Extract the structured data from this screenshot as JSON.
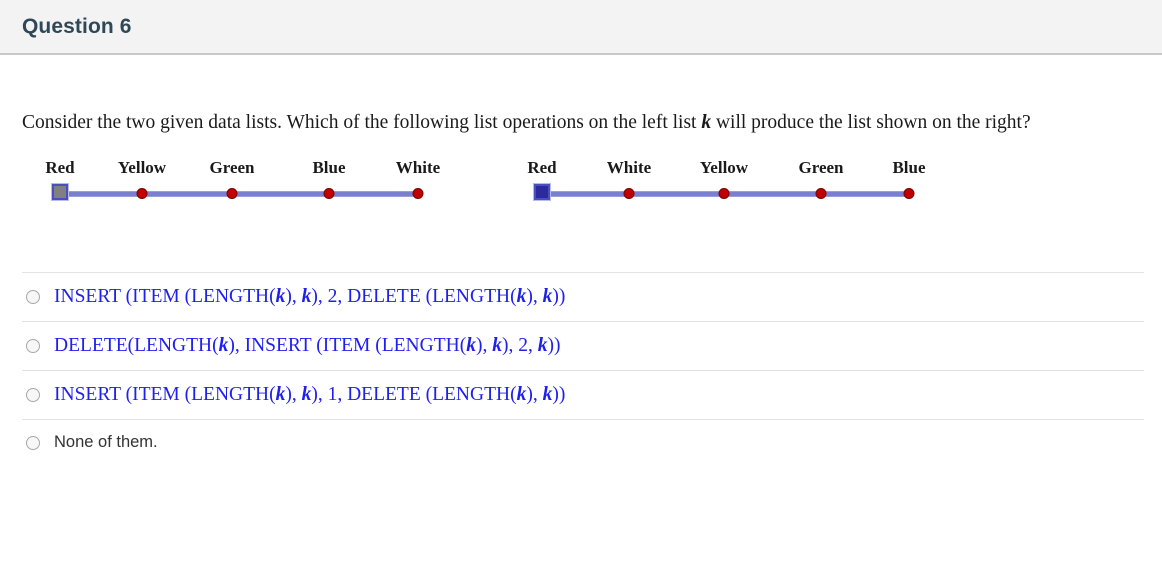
{
  "header": {
    "title": "Question 6"
  },
  "prompt": {
    "before_var": "Consider the two given data lists. Which of the following list operations on the left list ",
    "var": "k",
    "after_var": " will produce the list shown on the right?"
  },
  "colors": {
    "header_background": "#f3f3f3",
    "title_text": "#2f4858",
    "option_text": "#2020ee",
    "line": "#7b7fd0",
    "dot": "#c00000",
    "square_left": "#808080",
    "square_right": "#2b2b9e"
  },
  "chart_data": {
    "type": "scatter",
    "lists": [
      {
        "name": "left-list",
        "items": [
          "Red",
          "Yellow",
          "Green",
          "Blue",
          "White"
        ],
        "x_positions": [
          28,
          110,
          200,
          297,
          386
        ],
        "marker_types": [
          "square-gray",
          "dot",
          "dot",
          "dot",
          "dot"
        ]
      },
      {
        "name": "right-list",
        "items": [
          "Red",
          "White",
          "Yellow",
          "Green",
          "Blue"
        ],
        "x_positions": [
          28,
          115,
          210,
          307,
          395
        ],
        "marker_types": [
          "square-blue",
          "dot",
          "dot",
          "dot",
          "dot"
        ]
      }
    ]
  },
  "options": [
    {
      "id": "option-1",
      "selected": false,
      "style": "formula",
      "segments": [
        {
          "t": "INSERT (ITEM (LENGTH(",
          "v": false
        },
        {
          "t": "k",
          "v": true
        },
        {
          "t": "), ",
          "v": false
        },
        {
          "t": "k",
          "v": true
        },
        {
          "t": "), 2, DELETE (LENGTH(",
          "v": false
        },
        {
          "t": "k",
          "v": true
        },
        {
          "t": "), ",
          "v": false
        },
        {
          "t": "k",
          "v": true
        },
        {
          "t": "))",
          "v": false
        }
      ],
      "text": "INSERT (ITEM (LENGTH(k), k), 2, DELETE (LENGTH(k), k))"
    },
    {
      "id": "option-2",
      "selected": false,
      "style": "formula",
      "segments": [
        {
          "t": "DELETE(LENGTH(",
          "v": false
        },
        {
          "t": "k",
          "v": true
        },
        {
          "t": "), INSERT (ITEM (LENGTH(",
          "v": false
        },
        {
          "t": "k",
          "v": true
        },
        {
          "t": "), ",
          "v": false
        },
        {
          "t": "k",
          "v": true
        },
        {
          "t": "), 2, ",
          "v": false
        },
        {
          "t": "k",
          "v": true
        },
        {
          "t": "))",
          "v": false
        }
      ],
      "text": "DELETE(LENGTH(k), INSERT (ITEM (LENGTH(k), k), 2, k))"
    },
    {
      "id": "option-3",
      "selected": false,
      "style": "formula",
      "segments": [
        {
          "t": "INSERT (ITEM (LENGTH(",
          "v": false
        },
        {
          "t": "k",
          "v": true
        },
        {
          "t": "), ",
          "v": false
        },
        {
          "t": "k",
          "v": true
        },
        {
          "t": "), 1, DELETE (LENGTH(",
          "v": false
        },
        {
          "t": "k",
          "v": true
        },
        {
          "t": "), ",
          "v": false
        },
        {
          "t": "k",
          "v": true
        },
        {
          "t": "))",
          "v": false
        }
      ],
      "text": "INSERT (ITEM (LENGTH(k), k), 1, DELETE (LENGTH(k), k))"
    },
    {
      "id": "option-4",
      "selected": false,
      "style": "plain",
      "segments": [
        {
          "t": "None of them.",
          "v": false
        }
      ],
      "text": "None of them."
    }
  ]
}
